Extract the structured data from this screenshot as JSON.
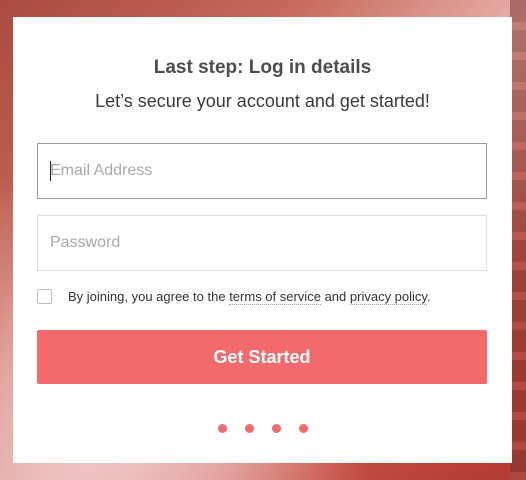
{
  "header": {
    "title": "Last step: Log in details",
    "subtitle": "Let’s secure your account and get started!"
  },
  "form": {
    "email_placeholder": "Email Address",
    "password_placeholder": "Password",
    "consent": {
      "prefix": "By joining, you agree to the",
      "terms_link": "terms of service",
      "middle": "and",
      "privacy_link": "privacy policy",
      "suffix": ".",
      "checked": false
    },
    "submit_label": "Get Started"
  },
  "progress": {
    "total_steps": 4
  },
  "colors": {
    "accent": "#f26a6c"
  }
}
